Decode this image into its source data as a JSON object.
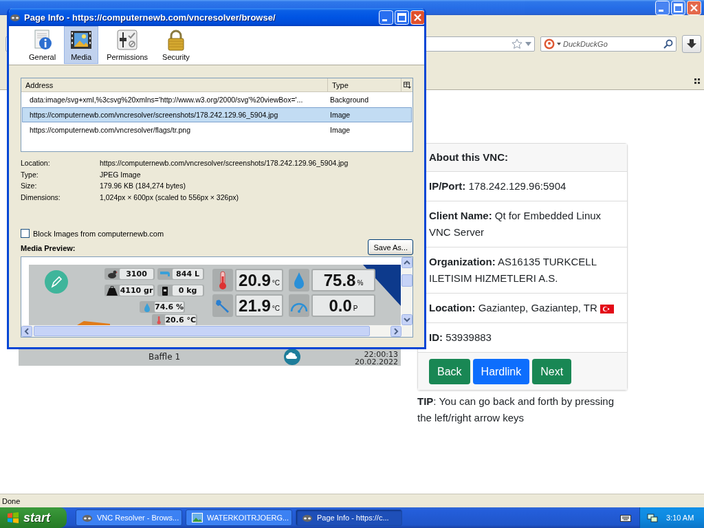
{
  "browser": {
    "search": {
      "placeholder": "DuckDuckGo"
    },
    "status": "Done"
  },
  "page": {
    "screenshot": {
      "label": "Baffle 1",
      "time": "22:00:13",
      "date": "20.02.2022"
    },
    "card": {
      "title": "About this VNC:",
      "rows": [
        {
          "label": "IP/Port:",
          "value": "178.242.129.96:5904",
          "flag": false
        },
        {
          "label": "Client Name:",
          "value": "Qt for Embedded Linux VNC Server",
          "flag": false
        },
        {
          "label": "Organization:",
          "value": "AS16135 TURKCELL ILETISIM HIZMETLERI A.S.",
          "flag": false
        },
        {
          "label": "Location:",
          "value": "Gaziantep, Gaziantep, TR",
          "flag": true
        },
        {
          "label": "ID:",
          "value": "53939883",
          "flag": false
        }
      ],
      "buttons": [
        {
          "label": "Back",
          "kind": "success"
        },
        {
          "label": "Hardlink",
          "kind": "primary"
        },
        {
          "label": "Next",
          "kind": "success"
        }
      ]
    },
    "tip": "**TIP**: You can go back and forth by pressing the left/right arrow keys"
  },
  "dialog": {
    "title": "Page Info - https://computernewb.com/vncresolver/browse/",
    "tabs": [
      {
        "label": "General",
        "selected": false
      },
      {
        "label": "Media",
        "selected": true
      },
      {
        "label": "Permissions",
        "selected": false
      },
      {
        "label": "Security",
        "selected": false
      }
    ],
    "columns": [
      "Address",
      "Type"
    ],
    "rows": [
      {
        "address": "data:image/svg+xml,%3csvg%20xmlns='http://www.w3.org/2000/svg'%20viewBox='...",
        "type": "Background",
        "selected": false
      },
      {
        "address": "https://computernewb.com/vncresolver/screenshots/178.242.129.96_5904.jpg",
        "type": "Image",
        "selected": true
      },
      {
        "address": "https://computernewb.com/vncresolver/flags/tr.png",
        "type": "Image",
        "selected": false
      }
    ],
    "details": [
      {
        "label": "Location:",
        "value": "https://computernewb.com/vncresolver/screenshots/178.242.129.96_5904.jpg"
      },
      {
        "label": "Type:",
        "value": "JPEG Image"
      },
      {
        "label": "Size:",
        "value": "179.96 KB (184,274 bytes)"
      },
      {
        "label": "Dimensions:",
        "value": "1,024px × 600px (scaled to 556px × 326px)"
      }
    ],
    "block_images": {
      "label": "Block Images from computernewb.com",
      "checked": false
    },
    "save_button": "Save As...",
    "preview_label": "Media Preview:",
    "preview": {
      "small_tiles": [
        {
          "value": "3100"
        },
        {
          "value": "844 L"
        },
        {
          "value": "4110 gr"
        },
        {
          "value": "0 kg"
        },
        {
          "value": "74.6 %"
        },
        {
          "value": "20.6 °C"
        }
      ],
      "big_tiles": [
        {
          "value": "20.9",
          "unit": "°C"
        },
        {
          "value": "75.8",
          "unit": "%"
        },
        {
          "value": "21.9",
          "unit": "°C"
        },
        {
          "value": "0.0",
          "unit": "P"
        }
      ]
    }
  },
  "taskbar": {
    "start": "start",
    "tasks": [
      {
        "label": "VNC Resolver - Brows...",
        "selected": false
      },
      {
        "label": "WATERKOITRJOERG...",
        "selected": false
      },
      {
        "label": "Page Info - https://c...",
        "selected": true
      }
    ],
    "clock": "3:10 AM"
  }
}
